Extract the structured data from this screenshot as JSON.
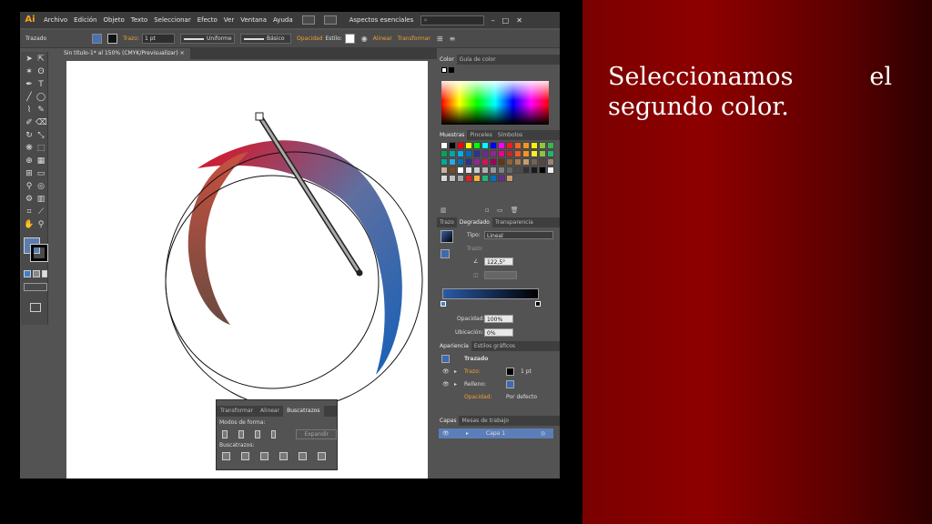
{
  "slide": {
    "text": "Seleccionamos el segundo color.",
    "background_colors": [
      "#8e0000",
      "#2c0000"
    ]
  },
  "app": {
    "logo": "Ai",
    "menu": [
      "Archivo",
      "Edición",
      "Objeto",
      "Texto",
      "Seleccionar",
      "Efecto",
      "Ver",
      "Ventana",
      "Ayuda"
    ],
    "workspace": "Aspectos esenciales",
    "window_controls": [
      "–",
      "□",
      "✕"
    ]
  },
  "control_bar": {
    "selection": "Trazado",
    "stroke_label": "Trazo:",
    "stroke_weight": "1 pt",
    "stroke_profile": "Uniforme",
    "brush": "Básico",
    "opacity_label": "Opacidad",
    "style_label": "Estilo:",
    "align_label": "Alinear",
    "transform_label": "Transformar"
  },
  "document": {
    "tab_title": "Sin título-1* al 150% (CMYK/Previsualizar)",
    "tab_close": "×"
  },
  "pathfinder": {
    "tabs": [
      "Transformar",
      "Alinear",
      "Buscatrazos"
    ],
    "active_tab": "Buscatrazos",
    "shape_modes_label": "Modos de forma:",
    "expand_button": "Expandir",
    "pathfinders_label": "Buscatrazos:"
  },
  "color_panel": {
    "tabs": [
      "Color",
      "Guía de color"
    ],
    "active_tab": "Color"
  },
  "swatches_panel": {
    "tabs": [
      "Muestras",
      "Pinceles",
      "Símbolos"
    ],
    "active_tab": "Muestras",
    "colors": [
      "#ffffff",
      "#000000",
      "#ff0000",
      "#ffff00",
      "#00ff00",
      "#00ffff",
      "#0000ff",
      "#ff00ff",
      "#ed1c24",
      "#f26522",
      "#f7941d",
      "#fff200",
      "#8dc63f",
      "#39b54a",
      "#00a651",
      "#00a99d",
      "#00aeef",
      "#0072bc",
      "#2e3192",
      "#662d91",
      "#92278f",
      "#ec008c",
      "#c1272d",
      "#f15a24",
      "#f7931e",
      "#fcee21",
      "#8cc63f",
      "#22b573",
      "#00a99d",
      "#29abe2",
      "#0071bc",
      "#2e3192",
      "#93278f",
      "#d4145a",
      "#9e005d",
      "#603813",
      "#8c6239",
      "#a67c52",
      "#c69c6d",
      "#736357",
      "#534741",
      "#998675",
      "#c7b299",
      "#754c24",
      "#ffffff",
      "#e6e6e6",
      "#cccccc",
      "#b3b3b3",
      "#999999",
      "#808080",
      "#666666",
      "#4d4d4d",
      "#333333",
      "#1a1a1a",
      "#000000",
      "#f2f2f2",
      "#d9d9d9",
      "#bfbfbf",
      "#a6a6a6",
      "#ed1c24",
      "#fbb03b",
      "#22b573",
      "#0071bc",
      "#662d91",
      "#c69c6d"
    ]
  },
  "gradient_panel": {
    "tabs": [
      "Trazo",
      "Degradado",
      "Transparencia"
    ],
    "active_tab": "Degradado",
    "type_label": "Tipo:",
    "type_value": "Lineal",
    "stroke_label": "Trazo:",
    "angle_value": "122,5°",
    "opacity_label": "Opacidad:",
    "opacity_value": "100%",
    "location_label": "Ubicación:",
    "location_value": "0%",
    "start_color": "#2a5aa8",
    "end_color": "#000000"
  },
  "appearance_panel": {
    "tabs": [
      "Apariencia",
      "Estilos gráficos"
    ],
    "active_tab": "Apariencia",
    "title": "Trazado",
    "rows": [
      {
        "label": "Trazo:",
        "value": "1 pt"
      },
      {
        "label": "Relleno:",
        "value": ""
      },
      {
        "label": "Opacidad:",
        "value": "Por defecto"
      }
    ]
  },
  "layers_panel": {
    "tabs": [
      "Capas",
      "Mesas de trabajo"
    ],
    "active_tab": "Capas",
    "layers": [
      "Capa 1"
    ]
  },
  "toolbox": {
    "fill_color": "#5a7db0",
    "stroke_color": "#000000"
  }
}
